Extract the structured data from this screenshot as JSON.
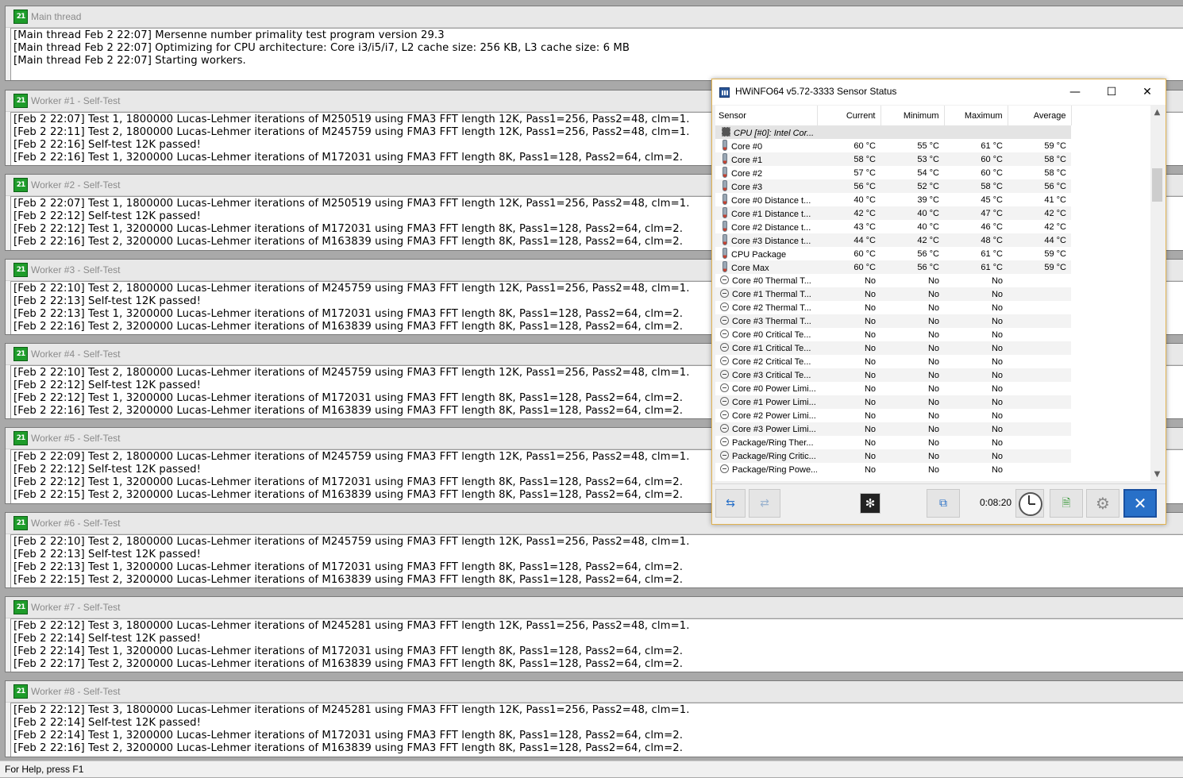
{
  "main": {
    "title": "Main thread",
    "lines": [
      "[Main thread Feb 2 22:07] Mersenne number primality test program version 29.3",
      "[Main thread Feb 2 22:07] Optimizing for CPU architecture: Core i3/i5/i7, L2 cache size: 256 KB, L3 cache size: 6 MB",
      "[Main thread Feb 2 22:07] Starting workers."
    ]
  },
  "workers": [
    {
      "title": "Worker #1 - Self-Test",
      "lines": [
        "[Feb 2 22:07] Test 1, 1800000 Lucas-Lehmer iterations of M250519 using FMA3 FFT length 12K, Pass1=256, Pass2=48, clm=1.",
        "[Feb 2 22:11] Test 2, 1800000 Lucas-Lehmer iterations of M245759 using FMA3 FFT length 12K, Pass1=256, Pass2=48, clm=1.",
        "[Feb 2 22:16] Self-test 12K passed!",
        "[Feb 2 22:16] Test 1, 3200000 Lucas-Lehmer iterations of M172031 using FMA3 FFT length 8K, Pass1=128, Pass2=64, clm=2."
      ]
    },
    {
      "title": "Worker #2 - Self-Test",
      "lines": [
        "[Feb 2 22:07] Test 1, 1800000 Lucas-Lehmer iterations of M250519 using FMA3 FFT length 12K, Pass1=256, Pass2=48, clm=1.",
        "[Feb 2 22:12] Self-test 12K passed!",
        "[Feb 2 22:12] Test 1, 3200000 Lucas-Lehmer iterations of M172031 using FMA3 FFT length 8K, Pass1=128, Pass2=64, clm=2.",
        "[Feb 2 22:16] Test 2, 3200000 Lucas-Lehmer iterations of M163839 using FMA3 FFT length 8K, Pass1=128, Pass2=64, clm=2."
      ]
    },
    {
      "title": "Worker #3 - Self-Test",
      "lines": [
        "[Feb 2 22:10] Test 2, 1800000 Lucas-Lehmer iterations of M245759 using FMA3 FFT length 12K, Pass1=256, Pass2=48, clm=1.",
        "[Feb 2 22:13] Self-test 12K passed!",
        "[Feb 2 22:13] Test 1, 3200000 Lucas-Lehmer iterations of M172031 using FMA3 FFT length 8K, Pass1=128, Pass2=64, clm=2.",
        "[Feb 2 22:16] Test 2, 3200000 Lucas-Lehmer iterations of M163839 using FMA3 FFT length 8K, Pass1=128, Pass2=64, clm=2."
      ]
    },
    {
      "title": "Worker #4 - Self-Test",
      "lines": [
        "[Feb 2 22:10] Test 2, 1800000 Lucas-Lehmer iterations of M245759 using FMA3 FFT length 12K, Pass1=256, Pass2=48, clm=1.",
        "[Feb 2 22:12] Self-test 12K passed!",
        "[Feb 2 22:12] Test 1, 3200000 Lucas-Lehmer iterations of M172031 using FMA3 FFT length 8K, Pass1=128, Pass2=64, clm=2.",
        "[Feb 2 22:16] Test 2, 3200000 Lucas-Lehmer iterations of M163839 using FMA3 FFT length 8K, Pass1=128, Pass2=64, clm=2."
      ]
    },
    {
      "title": "Worker #5 - Self-Test",
      "lines": [
        "[Feb 2 22:09] Test 2, 1800000 Lucas-Lehmer iterations of M245759 using FMA3 FFT length 12K, Pass1=256, Pass2=48, clm=1.",
        "[Feb 2 22:12] Self-test 12K passed!",
        "[Feb 2 22:12] Test 1, 3200000 Lucas-Lehmer iterations of M172031 using FMA3 FFT length 8K, Pass1=128, Pass2=64, clm=2.",
        "[Feb 2 22:15] Test 2, 3200000 Lucas-Lehmer iterations of M163839 using FMA3 FFT length 8K, Pass1=128, Pass2=64, clm=2."
      ]
    },
    {
      "title": "Worker #6 - Self-Test",
      "lines": [
        "[Feb 2 22:10] Test 2, 1800000 Lucas-Lehmer iterations of M245759 using FMA3 FFT length 12K, Pass1=256, Pass2=48, clm=1.",
        "[Feb 2 22:13] Self-test 12K passed!",
        "[Feb 2 22:13] Test 1, 3200000 Lucas-Lehmer iterations of M172031 using FMA3 FFT length 8K, Pass1=128, Pass2=64, clm=2.",
        "[Feb 2 22:15] Test 2, 3200000 Lucas-Lehmer iterations of M163839 using FMA3 FFT length 8K, Pass1=128, Pass2=64, clm=2."
      ]
    },
    {
      "title": "Worker #7 - Self-Test",
      "lines": [
        "[Feb 2 22:12] Test 3, 1800000 Lucas-Lehmer iterations of M245281 using FMA3 FFT length 12K, Pass1=256, Pass2=48, clm=1.",
        "[Feb 2 22:14] Self-test 12K passed!",
        "[Feb 2 22:14] Test 1, 3200000 Lucas-Lehmer iterations of M172031 using FMA3 FFT length 8K, Pass1=128, Pass2=64, clm=2.",
        "[Feb 2 22:17] Test 2, 3200000 Lucas-Lehmer iterations of M163839 using FMA3 FFT length 8K, Pass1=128, Pass2=64, clm=2."
      ]
    },
    {
      "title": "Worker #8 - Self-Test",
      "lines": [
        "[Feb 2 22:12] Test 3, 1800000 Lucas-Lehmer iterations of M245281 using FMA3 FFT length 12K, Pass1=256, Pass2=48, clm=1.",
        "[Feb 2 22:14] Self-test 12K passed!",
        "[Feb 2 22:14] Test 1, 3200000 Lucas-Lehmer iterations of M172031 using FMA3 FFT length 8K, Pass1=128, Pass2=64, clm=2.",
        "[Feb 2 22:16] Test 2, 3200000 Lucas-Lehmer iterations of M163839 using FMA3 FFT length 8K, Pass1=128, Pass2=64, clm=2."
      ]
    }
  ],
  "statusbar": "For Help, press F1",
  "app_icon_text": "21",
  "hwinfo": {
    "title": "HWiNFO64 v5.72-3333 Sensor Status",
    "columns": [
      "Sensor",
      "Current",
      "Minimum",
      "Maximum",
      "Average"
    ],
    "group": "CPU [#0]: Intel Cor...",
    "rows": [
      {
        "icon": "thermometer",
        "name": "Core #0",
        "cur": "60 °C",
        "min": "55 °C",
        "max": "61 °C",
        "avg": "59 °C"
      },
      {
        "icon": "thermometer",
        "name": "Core #1",
        "cur": "58 °C",
        "min": "53 °C",
        "max": "60 °C",
        "avg": "58 °C"
      },
      {
        "icon": "thermometer",
        "name": "Core #2",
        "cur": "57 °C",
        "min": "54 °C",
        "max": "60 °C",
        "avg": "58 °C"
      },
      {
        "icon": "thermometer",
        "name": "Core #3",
        "cur": "56 °C",
        "min": "52 °C",
        "max": "58 °C",
        "avg": "56 °C"
      },
      {
        "icon": "thermometer",
        "name": "Core #0 Distance t...",
        "cur": "40 °C",
        "min": "39 °C",
        "max": "45 °C",
        "avg": "41 °C"
      },
      {
        "icon": "thermometer",
        "name": "Core #1 Distance t...",
        "cur": "42 °C",
        "min": "40 °C",
        "max": "47 °C",
        "avg": "42 °C"
      },
      {
        "icon": "thermometer",
        "name": "Core #2 Distance t...",
        "cur": "43 °C",
        "min": "40 °C",
        "max": "46 °C",
        "avg": "42 °C"
      },
      {
        "icon": "thermometer",
        "name": "Core #3 Distance t...",
        "cur": "44 °C",
        "min": "42 °C",
        "max": "48 °C",
        "avg": "44 °C"
      },
      {
        "icon": "thermometer",
        "name": "CPU Package",
        "cur": "60 °C",
        "min": "56 °C",
        "max": "61 °C",
        "avg": "59 °C"
      },
      {
        "icon": "thermometer",
        "name": "Core Max",
        "cur": "60 °C",
        "min": "56 °C",
        "max": "61 °C",
        "avg": "59 °C"
      },
      {
        "icon": "no-entry",
        "name": "Core #0 Thermal T...",
        "cur": "No",
        "min": "No",
        "max": "No",
        "avg": ""
      },
      {
        "icon": "no-entry",
        "name": "Core #1 Thermal T...",
        "cur": "No",
        "min": "No",
        "max": "No",
        "avg": ""
      },
      {
        "icon": "no-entry",
        "name": "Core #2 Thermal T...",
        "cur": "No",
        "min": "No",
        "max": "No",
        "avg": ""
      },
      {
        "icon": "no-entry",
        "name": "Core #3 Thermal T...",
        "cur": "No",
        "min": "No",
        "max": "No",
        "avg": ""
      },
      {
        "icon": "no-entry",
        "name": "Core #0 Critical Te...",
        "cur": "No",
        "min": "No",
        "max": "No",
        "avg": ""
      },
      {
        "icon": "no-entry",
        "name": "Core #1 Critical Te...",
        "cur": "No",
        "min": "No",
        "max": "No",
        "avg": ""
      },
      {
        "icon": "no-entry",
        "name": "Core #2 Critical Te...",
        "cur": "No",
        "min": "No",
        "max": "No",
        "avg": ""
      },
      {
        "icon": "no-entry",
        "name": "Core #3 Critical Te...",
        "cur": "No",
        "min": "No",
        "max": "No",
        "avg": ""
      },
      {
        "icon": "no-entry",
        "name": "Core #0 Power Limi...",
        "cur": "No",
        "min": "No",
        "max": "No",
        "avg": ""
      },
      {
        "icon": "no-entry",
        "name": "Core #1 Power Limi...",
        "cur": "No",
        "min": "No",
        "max": "No",
        "avg": ""
      },
      {
        "icon": "no-entry",
        "name": "Core #2 Power Limi...",
        "cur": "No",
        "min": "No",
        "max": "No",
        "avg": ""
      },
      {
        "icon": "no-entry",
        "name": "Core #3 Power Limi...",
        "cur": "No",
        "min": "No",
        "max": "No",
        "avg": ""
      },
      {
        "icon": "no-entry",
        "name": "Package/Ring Ther...",
        "cur": "No",
        "min": "No",
        "max": "No",
        "avg": ""
      },
      {
        "icon": "no-entry",
        "name": "Package/Ring Critic...",
        "cur": "No",
        "min": "No",
        "max": "No",
        "avg": ""
      },
      {
        "icon": "no-entry",
        "name": "Package/Ring Powe...",
        "cur": "No",
        "min": "No",
        "max": "No",
        "avg": ""
      }
    ],
    "timer": "0:08:20",
    "toolbar_icons": [
      "expand-arrows-icon",
      "collapse-arrows-icon",
      "fan-icon",
      "network-icon",
      "clock-icon",
      "add-report-icon",
      "settings-icon",
      "close-icon"
    ]
  },
  "colors": {
    "accent_border": "#e2b350",
    "prime95_icon": "#1e9c2a",
    "close_button": "#2870c8"
  }
}
